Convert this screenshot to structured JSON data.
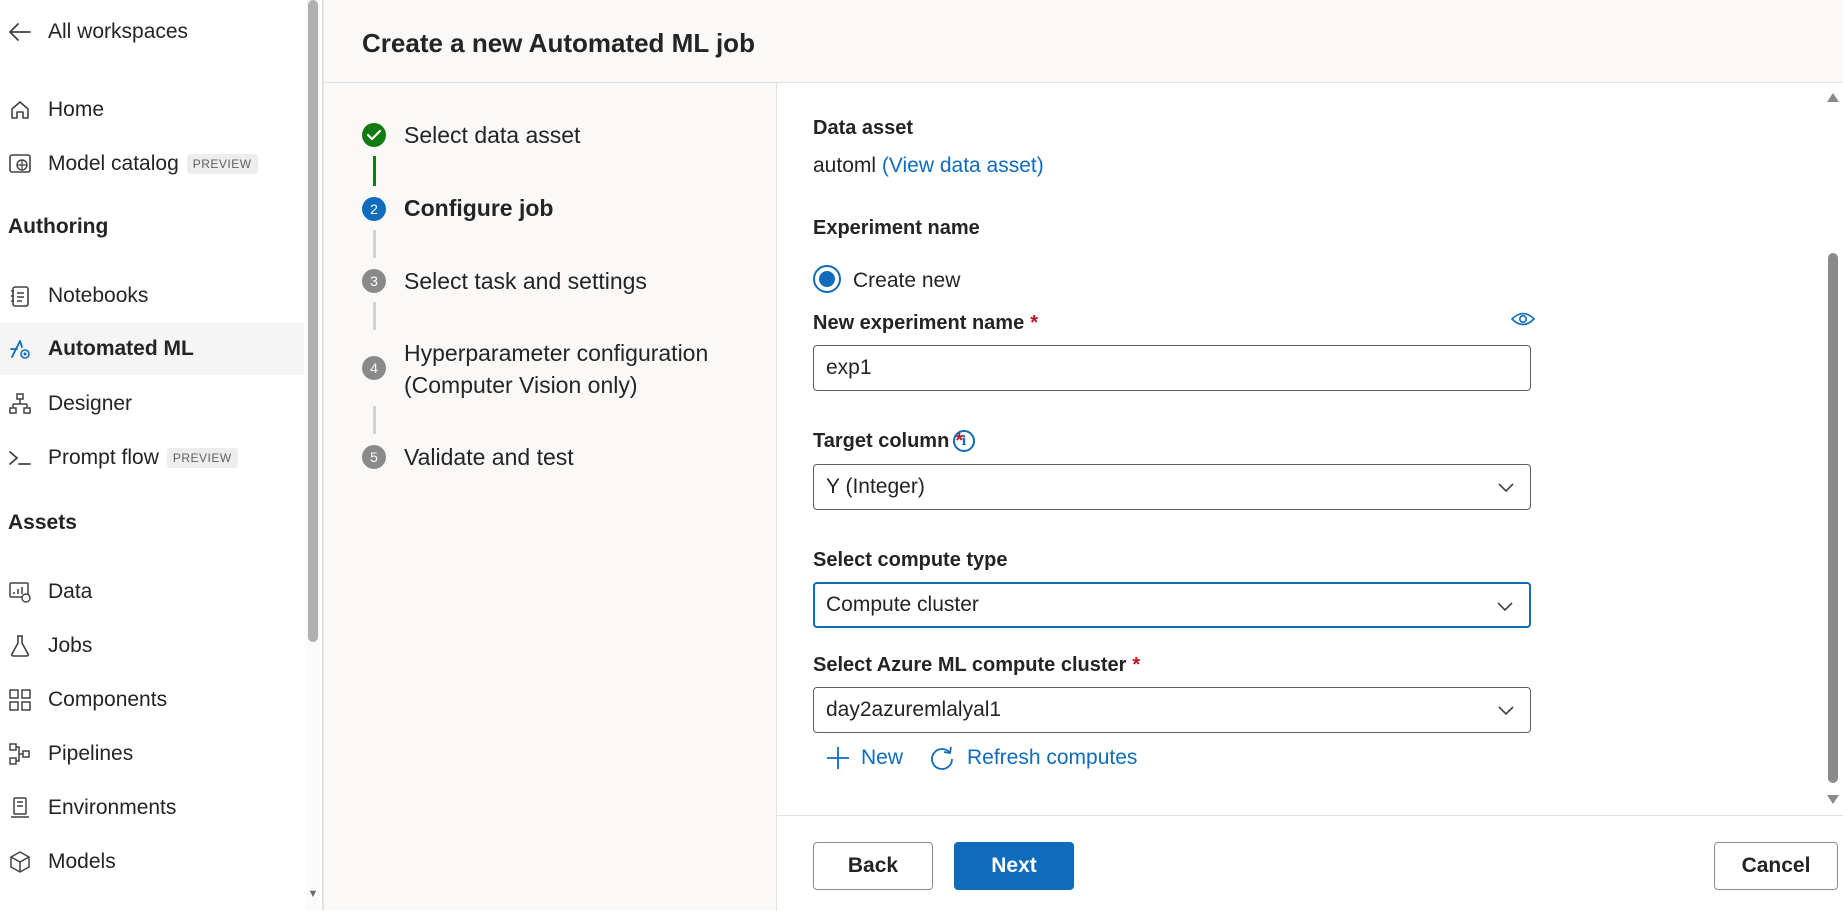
{
  "sidebar": {
    "back_label": "All workspaces",
    "items_top": [
      {
        "label": "Home",
        "icon": "home-icon"
      },
      {
        "label": "Model catalog",
        "icon": "globe-icon",
        "badge": "PREVIEW"
      }
    ],
    "authoring_title": "Authoring",
    "authoring_items": [
      {
        "label": "Notebooks",
        "icon": "notebook-icon"
      },
      {
        "label": "Automated ML",
        "icon": "automl-icon"
      },
      {
        "label": "Designer",
        "icon": "designer-icon"
      },
      {
        "label": "Prompt flow",
        "icon": "prompt-icon",
        "badge": "PREVIEW"
      }
    ],
    "assets_title": "Assets",
    "assets_items": [
      {
        "label": "Data",
        "icon": "data-icon"
      },
      {
        "label": "Jobs",
        "icon": "flask-icon"
      },
      {
        "label": "Components",
        "icon": "components-icon"
      },
      {
        "label": "Pipelines",
        "icon": "pipelines-icon"
      },
      {
        "label": "Environments",
        "icon": "environments-icon"
      },
      {
        "label": "Models",
        "icon": "cube-icon"
      }
    ]
  },
  "page": {
    "title": "Create a new Automated ML job"
  },
  "steps": [
    {
      "label": "Select data asset",
      "state": "done"
    },
    {
      "label": "Configure job",
      "state": "current",
      "number": "2"
    },
    {
      "label": "Select task and settings",
      "state": "todo",
      "number": "3"
    },
    {
      "label_line1": "Hyperparameter configuration",
      "label_line2": "(Computer Vision only)",
      "state": "todo",
      "number": "4"
    },
    {
      "label": "Validate and test",
      "state": "todo",
      "number": "5"
    }
  ],
  "form": {
    "data_asset_label": "Data asset",
    "data_asset_value": "automl",
    "view_data_asset_link": "(View data asset)",
    "experiment_name_label": "Experiment name",
    "create_new_radio": "Create new",
    "new_experiment_name_label": "New experiment name",
    "new_experiment_name_value": "exp1",
    "target_column_label": "Target column",
    "target_column_value": "Y (Integer)",
    "compute_type_label": "Select compute type",
    "compute_type_value": "Compute cluster",
    "compute_cluster_label": "Select Azure ML compute cluster",
    "compute_cluster_value": "day2azuremlalyal1",
    "new_button": "New",
    "refresh_button": "Refresh computes",
    "required_mark": "*"
  },
  "footer": {
    "back_button": "Back",
    "next_button": "Next",
    "cancel_button": "Cancel"
  },
  "colors": {
    "accent": "#0f6cbd",
    "success": "#107c10",
    "required": "#c50f1f"
  }
}
